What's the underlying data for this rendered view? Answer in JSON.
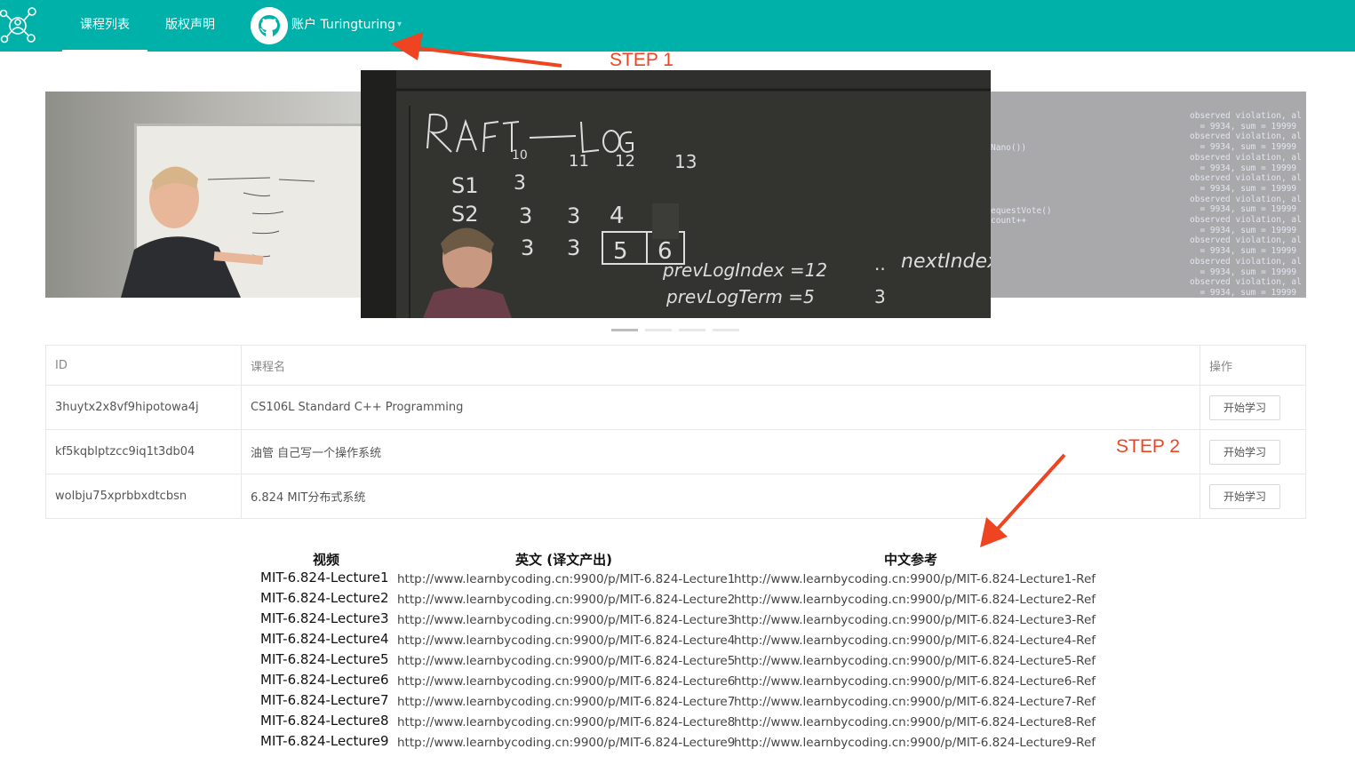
{
  "nav": {
    "items": [
      {
        "label": "课程列表",
        "active": true
      },
      {
        "label": "版权声明",
        "active": false
      }
    ],
    "account_label": "账户 Turingturing",
    "brand_color": "#00b1aa"
  },
  "carousel": {
    "slide_count": 4,
    "active_index": 0,
    "right_code_lines": [
      "observed violation, al",
      "  = 9934, sum = 19999",
      "observed violation, al",
      "  = 9934, sum = 19999",
      "observed violation, al",
      "  = 9934, sum = 19999",
      "observed violation, al",
      "  = 9934, sum = 19999",
      "observed violation, al",
      "  = 9934, sum = 19999",
      "observed violation, al",
      "  = 9934, sum = 19999",
      "observed violation, al",
      "  = 9934, sum = 19999",
      "observed violation, al",
      "  = 9934, sum = 19999",
      "observed violation, al",
      "  = 9934, sum = 19999"
    ],
    "mid_code_lines": [
      "Nano())",
      "",
      "",
      "",
      "",
      "",
      "",
      "equestVote()",
      "count++"
    ]
  },
  "table": {
    "headers": {
      "id": "ID",
      "name": "课程名",
      "op": "操作"
    },
    "rows": [
      {
        "id": "3huytx2x8vf9hipotowa4j",
        "name": "CS106L Standard C++ Programming",
        "button": "开始学习"
      },
      {
        "id": "kf5kqblptzcc9iq1t3db04",
        "name": "油管 自己写一个操作系统",
        "button": "开始学习"
      },
      {
        "id": "wolbju75xprbbxdtcbsn",
        "name": "6.824 MIT分布式系统",
        "button": "开始学习"
      }
    ]
  },
  "links": {
    "headers": {
      "video": "视频",
      "en": "英文 (译文产出)",
      "zh": "中文参考"
    },
    "rows": [
      {
        "video": "MIT-6.824-Lecture1",
        "en": "http://www.learnbycoding.cn:9900/p/MIT-6.824-Lecture1",
        "zh": "http://www.learnbycoding.cn:9900/p/MIT-6.824-Lecture1-Ref"
      },
      {
        "video": "MIT-6.824-Lecture2",
        "en": "http://www.learnbycoding.cn:9900/p/MIT-6.824-Lecture2",
        "zh": "http://www.learnbycoding.cn:9900/p/MIT-6.824-Lecture2-Ref"
      },
      {
        "video": "MIT-6.824-Lecture3",
        "en": "http://www.learnbycoding.cn:9900/p/MIT-6.824-Lecture3",
        "zh": "http://www.learnbycoding.cn:9900/p/MIT-6.824-Lecture3-Ref"
      },
      {
        "video": "MIT-6.824-Lecture4",
        "en": "http://www.learnbycoding.cn:9900/p/MIT-6.824-Lecture4",
        "zh": "http://www.learnbycoding.cn:9900/p/MIT-6.824-Lecture4-Ref"
      },
      {
        "video": "MIT-6.824-Lecture5",
        "en": "http://www.learnbycoding.cn:9900/p/MIT-6.824-Lecture5",
        "zh": "http://www.learnbycoding.cn:9900/p/MIT-6.824-Lecture5-Ref"
      },
      {
        "video": "MIT-6.824-Lecture6",
        "en": "http://www.learnbycoding.cn:9900/p/MIT-6.824-Lecture6",
        "zh": "http://www.learnbycoding.cn:9900/p/MIT-6.824-Lecture6-Ref"
      },
      {
        "video": "MIT-6.824-Lecture7",
        "en": "http://www.learnbycoding.cn:9900/p/MIT-6.824-Lecture7",
        "zh": "http://www.learnbycoding.cn:9900/p/MIT-6.824-Lecture7-Ref"
      },
      {
        "video": "MIT-6.824-Lecture8",
        "en": "http://www.learnbycoding.cn:9900/p/MIT-6.824-Lecture8",
        "zh": "http://www.learnbycoding.cn:9900/p/MIT-6.824-Lecture8-Ref"
      },
      {
        "video": "MIT-6.824-Lecture9",
        "en": "http://www.learnbycoding.cn:9900/p/MIT-6.824-Lecture9",
        "zh": "http://www.learnbycoding.cn:9900/p/MIT-6.824-Lecture9-Ref"
      }
    ]
  },
  "annotations": {
    "step1": "STEP 1",
    "step2": "STEP 2",
    "color": "#ee4422"
  },
  "icons": {
    "logo": "network-people-icon",
    "avatar": "github-octocat-icon",
    "caret": "chevron-down-icon"
  }
}
